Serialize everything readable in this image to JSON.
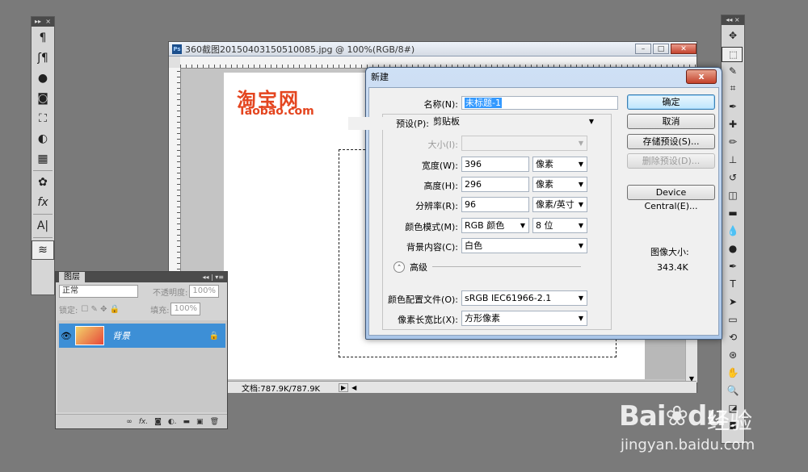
{
  "doc_window": {
    "title": "360截图20150403150510085.jpg @ 100%(RGB/8#)",
    "status": "文档:787.9K/787.9K",
    "logo_cn": "淘宝网",
    "logo_en": "Taobao.com"
  },
  "left_strip": {
    "icons": [
      "paragraph-icon",
      "character-style-icon",
      "3d-sphere-icon",
      "mask-icon",
      "transform-icon",
      "adjustment-icon",
      "grid-icon",
      "palette-icon",
      "fx-icon",
      "text-tool-icon",
      "layers-icon"
    ]
  },
  "layers_panel": {
    "tab": "图层",
    "blend_mode": "正常",
    "opacity_label": "不透明度:",
    "opacity_value": "100%",
    "lock_label": "锁定:",
    "fill_label": "填充:",
    "fill_value": "100%",
    "layer_name": "背景"
  },
  "dialog": {
    "title": "新建",
    "close": "x",
    "name_label": "名称(N):",
    "name_value": "未标题-1",
    "preset_label": "预设(P):",
    "preset_value": "剪贴板",
    "size_label": "大小(I):",
    "size_value": "",
    "width_label": "宽度(W):",
    "width_value": "396",
    "width_unit": "像素",
    "height_label": "高度(H):",
    "height_value": "296",
    "height_unit": "像素",
    "resolution_label": "分辨率(R):",
    "resolution_value": "96",
    "resolution_unit": "像素/英寸",
    "color_mode_label": "颜色模式(M):",
    "color_mode_value": "RGB 颜色",
    "bit_depth": "8 位",
    "bg_label": "背景内容(C):",
    "bg_value": "白色",
    "advanced_label": "高级",
    "profile_label": "颜色配置文件(O):",
    "profile_value": "sRGB IEC61966-2.1",
    "pixel_aspect_label": "像素长宽比(X):",
    "pixel_aspect_value": "方形像素",
    "ok": "确定",
    "cancel": "取消",
    "save_preset": "存储预设(S)...",
    "delete_preset": "删除预设(D)...",
    "device_central": "Device Central(E)...",
    "image_size_label": "图像大小:",
    "image_size_value": "343.4K"
  },
  "watermark": {
    "brand": "Bai",
    "brand2": "du",
    "cn": "经验",
    "url": "jingyan.baidu.com"
  }
}
